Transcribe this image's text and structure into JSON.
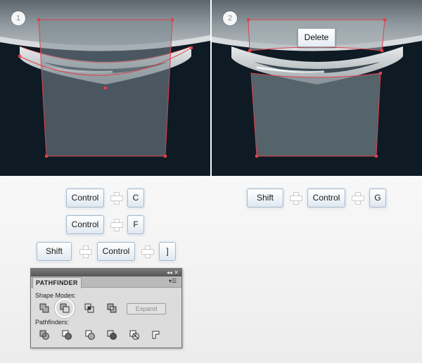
{
  "steps": [
    {
      "number": "1"
    },
    {
      "number": "2",
      "context_menu_item": "Delete"
    }
  ],
  "shortcut_rows_left": [
    [
      "Control",
      "C"
    ],
    [
      "Control",
      "F"
    ],
    [
      "Shift",
      "Control",
      "]"
    ]
  ],
  "shortcut_row_right": [
    "Shift",
    "Control",
    "G"
  ],
  "pathfinder": {
    "tab_title": "PATHFINDER",
    "shape_modes_label": "Shape Modes:",
    "pathfinders_label": "Pathfinders:",
    "expand_label": "Expand",
    "shape_mode_icons": [
      "unite-icon",
      "minus-front-icon",
      "intersect-icon",
      "exclude-icon"
    ],
    "highlighted_icon": "minus-front-icon",
    "pathfinder_icons": [
      "divide-icon",
      "trim-icon",
      "merge-icon",
      "crop-icon",
      "outline-icon",
      "minus-back-icon"
    ]
  },
  "colors": {
    "dark_background": "#0e1a24",
    "selection_outline": "#e0404a",
    "key_border": "#a8b8c8"
  }
}
